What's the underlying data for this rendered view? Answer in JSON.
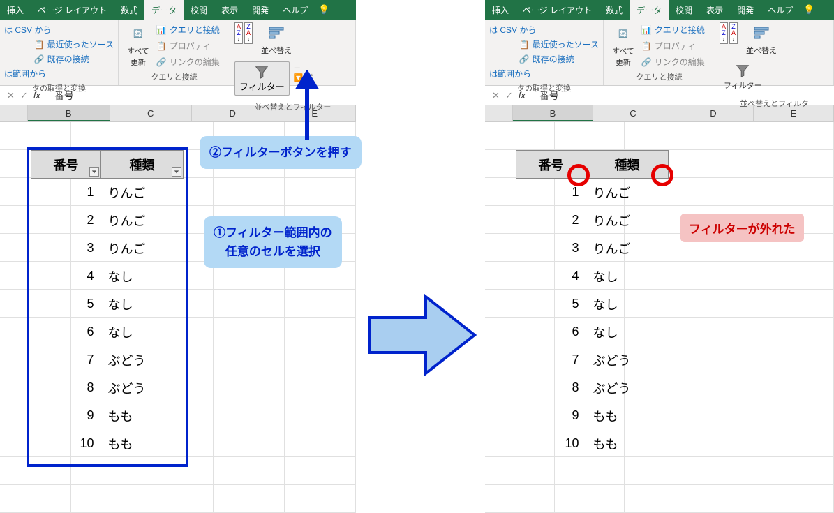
{
  "tabs": [
    "挿入",
    "ページ レイアウト",
    "数式",
    "データ",
    "校閲",
    "表示",
    "開発",
    "ヘルプ"
  ],
  "active_tab": "データ",
  "ribbon": {
    "csv_from": "は CSV から",
    "recent_sources": "最近使ったソース",
    "existing_conn": "既存の接続",
    "from_range": "は範囲から",
    "group1_label": "タの取得と変換",
    "refresh_all": "すべて\n更新",
    "query_conn": "クエリと接続",
    "properties": "プロパティ",
    "edit_links": "リンクの編集",
    "group2_label": "クエリと接続",
    "sort": "並べ替え",
    "filter": "フィルター",
    "group3_label": "並べ替えとフィルター",
    "group3_label_cut": "並べ替えとフィルタ"
  },
  "formula_bar": {
    "value": "番号"
  },
  "columns": [
    "B",
    "C",
    "D",
    "E"
  ],
  "table": {
    "headers": [
      "番号",
      "種類"
    ],
    "rows": [
      {
        "num": "1",
        "txt": "りんご"
      },
      {
        "num": "2",
        "txt": "りんご"
      },
      {
        "num": "3",
        "txt": "りんご"
      },
      {
        "num": "4",
        "txt": "なし"
      },
      {
        "num": "5",
        "txt": "なし"
      },
      {
        "num": "6",
        "txt": "なし"
      },
      {
        "num": "7",
        "txt": "ぶどう"
      },
      {
        "num": "8",
        "txt": "ぶどう"
      },
      {
        "num": "9",
        "txt": "もも"
      },
      {
        "num": "10",
        "txt": "もも"
      }
    ]
  },
  "callouts": {
    "step1": "①フィルター範囲内の\n任意のセルを選択",
    "step2": "②フィルターボタンを押す",
    "result": "フィルターが外れた"
  }
}
